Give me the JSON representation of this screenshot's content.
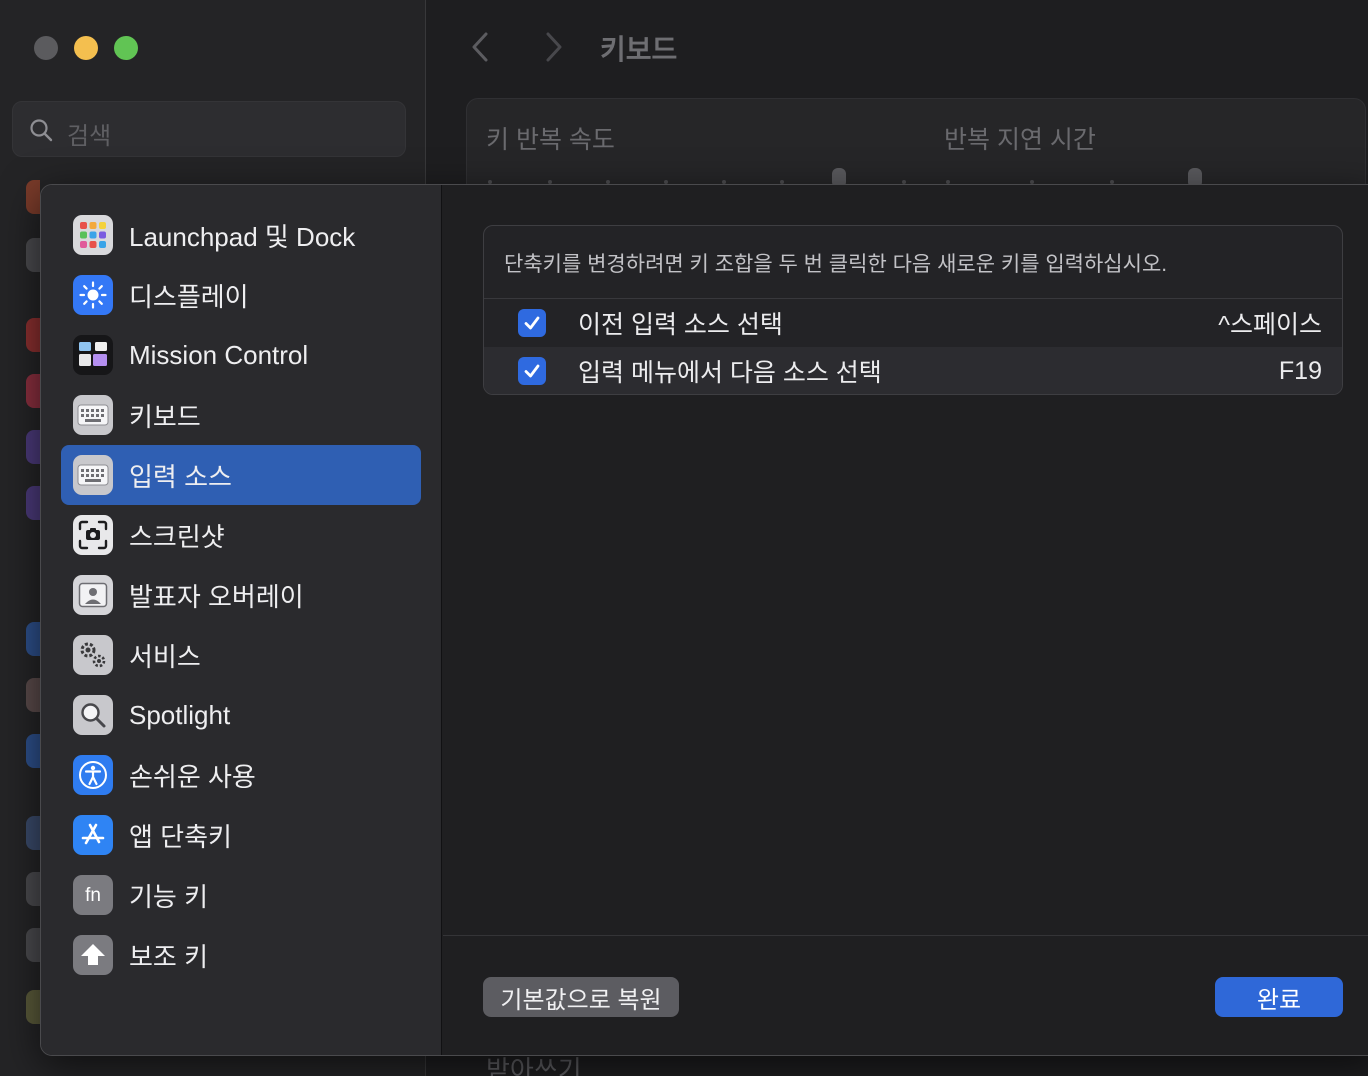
{
  "window": {
    "title": "키보드",
    "search_placeholder": "검색",
    "section_labels": {
      "key_repeat_rate": "키 반복 속도",
      "delay_until_repeat": "반복 지연 시간",
      "bottom_partial": "받아쓰기"
    }
  },
  "sheet": {
    "sidebar": {
      "items": [
        {
          "label": "Launchpad 및 Dock",
          "icon": "launchpad-icon"
        },
        {
          "label": "디스플레이",
          "icon": "display-brightness-icon"
        },
        {
          "label": "Mission Control",
          "icon": "mission-control-icon"
        },
        {
          "label": "키보드",
          "icon": "keyboard-icon"
        },
        {
          "label": "입력 소스",
          "icon": "keyboard-icon",
          "selected": true
        },
        {
          "label": "스크린샷",
          "icon": "screenshot-camera-icon"
        },
        {
          "label": "발표자 오버레이",
          "icon": "presenter-overlay-icon"
        },
        {
          "label": "서비스",
          "icon": "gears-icon"
        },
        {
          "label": "Spotlight",
          "icon": "magnifier-icon"
        },
        {
          "label": "손쉬운 사용",
          "icon": "accessibility-icon"
        },
        {
          "label": "앱 단축키",
          "icon": "app-store-icon"
        },
        {
          "label": "기능 키",
          "icon": "fn-key-icon"
        },
        {
          "label": "보조 키",
          "icon": "modifier-arrow-icon"
        }
      ]
    },
    "shortcuts": {
      "hint": "단축키를 변경하려면 키 조합을 두 번 클릭한 다음 새로운 키를 입력하십시오.",
      "rows": [
        {
          "checked": true,
          "label": "이전 입력 소스 선택",
          "key": "^스페이스"
        },
        {
          "checked": true,
          "label": "입력 메뉴에서 다음 소스 선택",
          "key": "F19"
        }
      ]
    },
    "buttons": {
      "restore_defaults": "기본값으로 복원",
      "done": "완료"
    }
  },
  "colors": {
    "accent": "#2f68d8",
    "selection": "#2f5fb3",
    "traffic_close": "#5b5b5e",
    "traffic_minimize": "#f4bf4f",
    "traffic_maximize": "#61c454"
  }
}
